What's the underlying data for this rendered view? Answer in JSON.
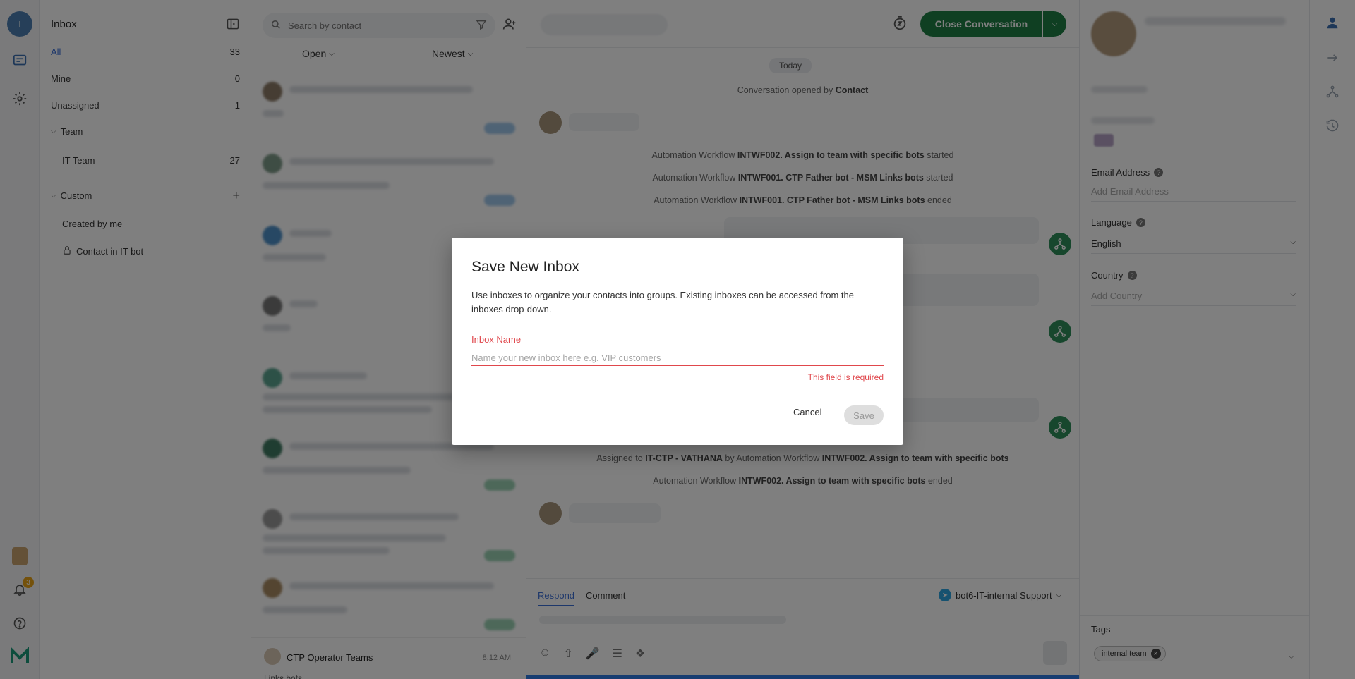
{
  "rail": {
    "avatar_letter": "I",
    "notification_count": "3"
  },
  "sidebar": {
    "title": "Inbox",
    "items": [
      {
        "label": "All",
        "count": "33"
      },
      {
        "label": "Mine",
        "count": "0"
      },
      {
        "label": "Unassigned",
        "count": "1"
      }
    ],
    "team_header": "Team",
    "team_items": [
      {
        "label": "IT Team",
        "count": "27"
      }
    ],
    "custom_header": "Custom",
    "custom_items": [
      {
        "label": "Created by me"
      },
      {
        "label": "Contact in IT bot"
      }
    ]
  },
  "conversation_list": {
    "search_placeholder": "Search by contact",
    "status_filter": "Open",
    "sort_filter": "Newest",
    "last_item": {
      "name": "CTP Operator Teams",
      "time": "8:12 AM",
      "preview": "Links bots"
    }
  },
  "chat": {
    "close_button": "Close Conversation",
    "day_label": "Today",
    "opened": {
      "prefix": "Conversation opened by",
      "who": "Contact"
    },
    "events": [
      {
        "prefix": "Automation Workflow",
        "name": "INTWF002. Assign to team with specific bots",
        "suffix": "started"
      },
      {
        "prefix": "Automation Workflow",
        "name": "INTWF001. CTP Father bot - MSM Links bots",
        "suffix": "started"
      },
      {
        "prefix": "Automation Workflow",
        "name": "INTWF001. CTP Father bot - MSM Links bots",
        "suffix": "ended"
      }
    ],
    "assigned": {
      "prefix": "Assigned to",
      "who": "IT-CTP - VATHANA",
      "mid": "by Automation Workflow",
      "name": "INTWF002. Assign to team with specific bots"
    },
    "ended": {
      "prefix": "Automation Workflow",
      "name": "INTWF002. Assign to team with specific bots",
      "suffix": "ended"
    },
    "composer": {
      "tab_respond": "Respond",
      "tab_comment": "Comment",
      "inbox_name": "bot6-IT-internal Support"
    }
  },
  "contact": {
    "email_label": "Email Address",
    "email_placeholder": "Add Email Address",
    "language_label": "Language",
    "language_value": "English",
    "country_label": "Country",
    "country_placeholder": "Add Country",
    "tags_label": "Tags",
    "tag": "internal team"
  },
  "modal": {
    "title": "Save New Inbox",
    "description": "Use inboxes to organize your contacts into groups. Existing inboxes can be accessed from the inboxes drop-down.",
    "field_label": "Inbox Name",
    "field_placeholder": "Name your new inbox here e.g. VIP customers",
    "field_value": "",
    "error": "This field is required",
    "cancel": "Cancel",
    "save": "Save"
  },
  "colors": {
    "accent": "#3b6fd6",
    "close_button": "#1e7f45",
    "error": "#e0474c"
  }
}
